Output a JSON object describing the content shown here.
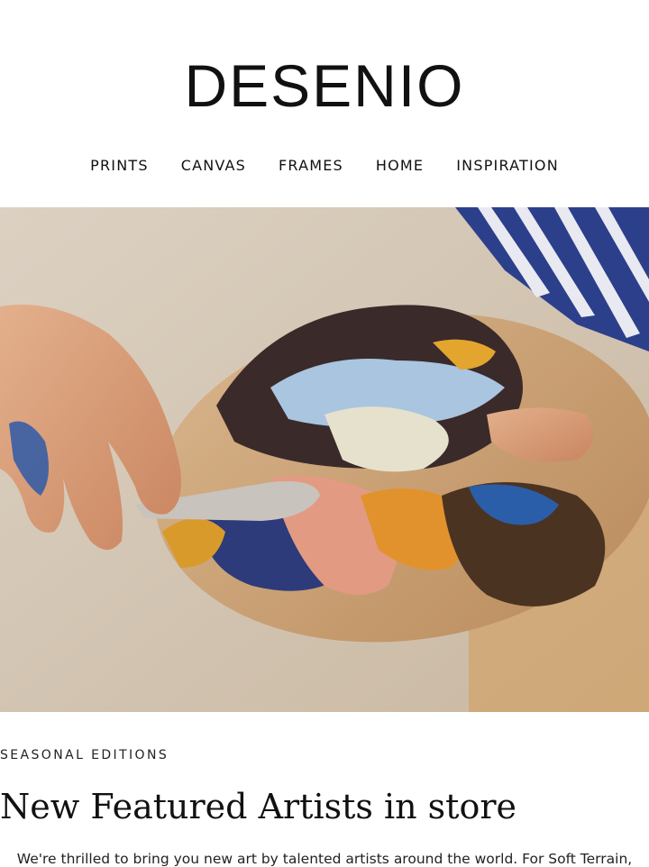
{
  "brand": {
    "logo_text": "DESENIO"
  },
  "nav": {
    "items": [
      {
        "label": "PRINTS"
      },
      {
        "label": "CANVAS"
      },
      {
        "label": "FRAMES"
      },
      {
        "label": "HOME"
      },
      {
        "label": "INSPIRATION"
      }
    ]
  },
  "hero": {
    "image_icon": "artist-palette-photo"
  },
  "content": {
    "eyebrow": "SEASONAL EDITIONS",
    "headline": "New Featured Artists in store",
    "body_text": "We're thrilled to bring you new art by talented artists around the world. For Soft Terrain,"
  }
}
